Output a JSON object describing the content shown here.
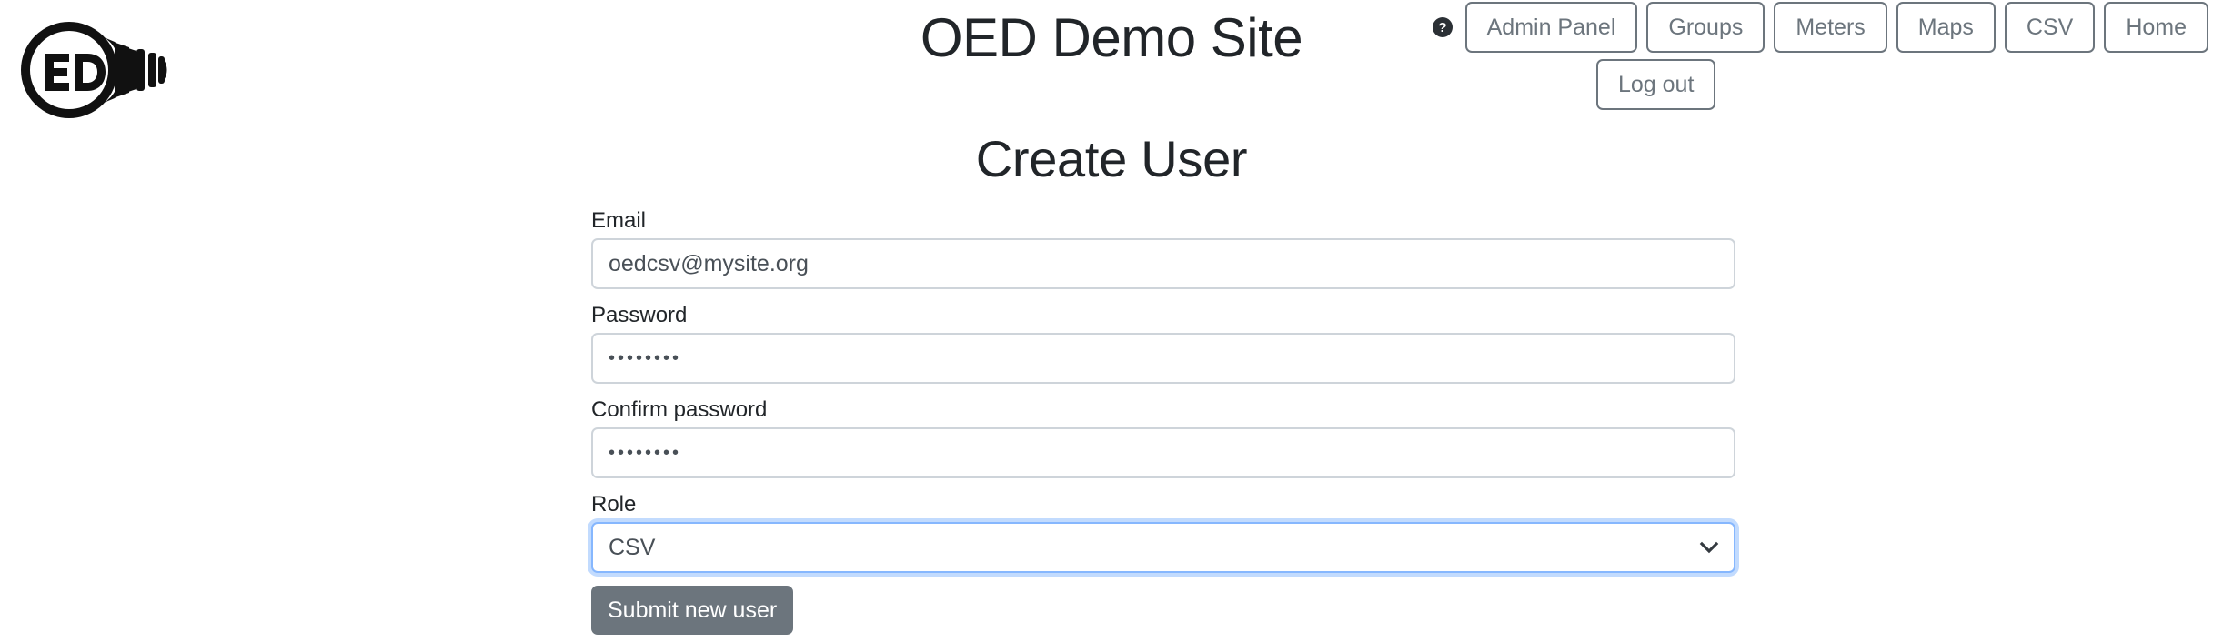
{
  "header": {
    "site_title": "OED Demo Site",
    "logo_alt": "oed-lightbulb-logo",
    "help_icon": "help-circle-icon",
    "nav_buttons": [
      {
        "label": "Admin Panel",
        "name": "nav-admin-panel"
      },
      {
        "label": "Groups",
        "name": "nav-groups"
      },
      {
        "label": "Meters",
        "name": "nav-meters"
      },
      {
        "label": "Maps",
        "name": "nav-maps"
      },
      {
        "label": "CSV",
        "name": "nav-csv"
      },
      {
        "label": "Home",
        "name": "nav-home"
      }
    ],
    "logout_label": "Log out"
  },
  "page": {
    "title": "Create User"
  },
  "form": {
    "email": {
      "label": "Email",
      "value": "oedcsv@mysite.org",
      "placeholder": ""
    },
    "password": {
      "label": "Password",
      "value": "••••••••",
      "placeholder": ""
    },
    "confirm_password": {
      "label": "Confirm password",
      "value": "••••••••",
      "placeholder": ""
    },
    "role": {
      "label": "Role",
      "selected": "CSV",
      "chevron_icon": "chevron-down-icon"
    },
    "submit_label": "Submit new user"
  },
  "colors": {
    "text": "#212529",
    "muted": "#6c757d",
    "border": "#ced4da",
    "focus_border": "#86b7fe",
    "button_bg": "#6c757d"
  }
}
